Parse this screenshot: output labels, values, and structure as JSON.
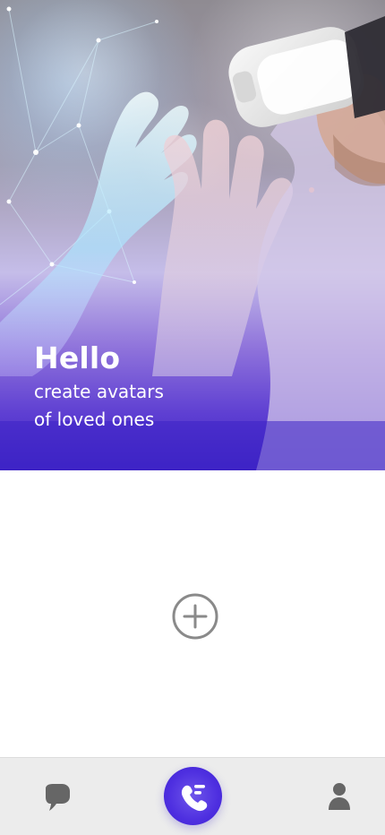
{
  "hero": {
    "title": "Hello",
    "subtitle_line_1": "create avatars",
    "subtitle_line_2": "of loved ones"
  },
  "icons": {
    "add": "plus-circle-icon",
    "chat": "chat-bubble-icon",
    "call": "phone-call-icon",
    "profile": "person-icon"
  },
  "colors": {
    "accent": "#4e2fe0",
    "nav_background": "#ececec",
    "icon_gray": "#666666"
  }
}
